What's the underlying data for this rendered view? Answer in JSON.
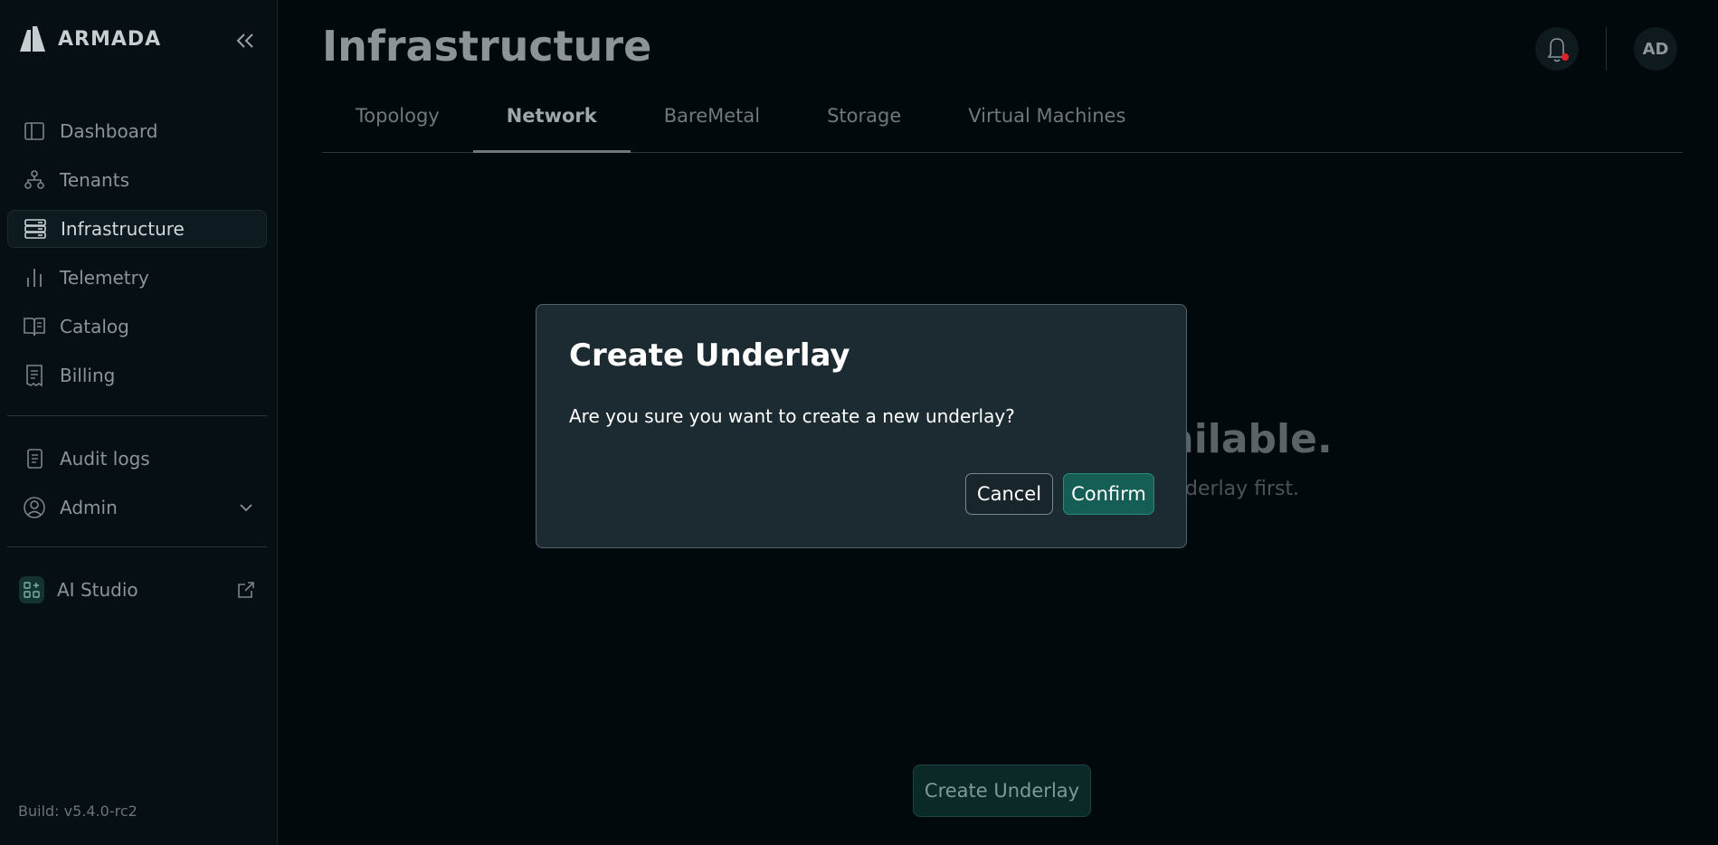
{
  "brand": {
    "name": "ARMADA"
  },
  "sidebar": {
    "items": [
      {
        "label": "Dashboard",
        "icon": "dashboard-icon"
      },
      {
        "label": "Tenants",
        "icon": "tenants-icon"
      },
      {
        "label": "Infrastructure",
        "icon": "infrastructure-icon",
        "active": true
      },
      {
        "label": "Telemetry",
        "icon": "telemetry-icon"
      },
      {
        "label": "Catalog",
        "icon": "catalog-icon"
      },
      {
        "label": "Billing",
        "icon": "billing-icon"
      }
    ],
    "secondary": [
      {
        "label": "Audit logs",
        "icon": "audit-logs-icon"
      },
      {
        "label": "Admin",
        "icon": "admin-icon"
      }
    ],
    "external": {
      "label": "AI Studio",
      "icon": "ai-studio-icon"
    },
    "build": "Build: v5.4.0-rc2"
  },
  "header": {
    "title": "Infrastructure",
    "avatar_initials": "AD",
    "notification_dot_color": "#e0242a"
  },
  "tabs": [
    {
      "label": "Topology"
    },
    {
      "label": "Network",
      "active": true
    },
    {
      "label": "BareMetal"
    },
    {
      "label": "Storage"
    },
    {
      "label": "Virtual Machines"
    }
  ],
  "empty_state": {
    "title_visible": "ailable.",
    "subtitle_visible": "derlay first."
  },
  "actions": {
    "create_underlay_label": "Create Underlay"
  },
  "modal": {
    "title": "Create Underlay",
    "message": "Are you sure you want to create a new underlay?",
    "cancel_label": "Cancel",
    "confirm_label": "Confirm"
  },
  "colors": {
    "accent": "#145e56",
    "background": "#02090c",
    "modal_bg": "#1c2a31"
  }
}
